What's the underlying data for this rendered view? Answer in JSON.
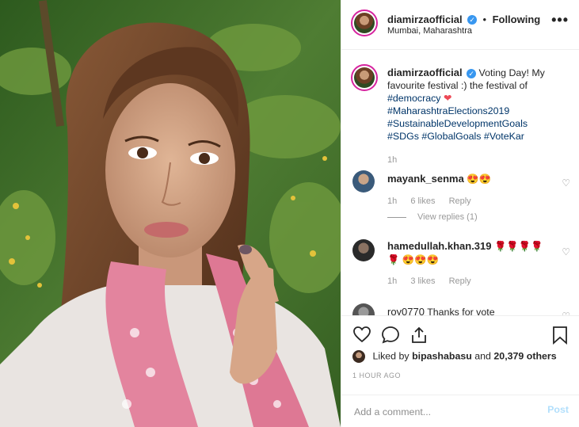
{
  "post": {
    "username": "diamirzaofficial",
    "verified_mark": "✓",
    "separator": "•",
    "follow_status": "Following",
    "location": "Mumbai, Maharashtra",
    "more_icon": "more-options-icon",
    "more_glyph": "•••"
  },
  "caption": {
    "username": "diamirzaofficial",
    "text": "Voting Day! My favourite festival :) the festival of",
    "tag1": "#democracy",
    "heart": "❤",
    "tag2": "#MaharashtraElections2019",
    "tag3": "#SustainableDevelopmentGoals",
    "tag4": "#SDGs",
    "tag5": "#GlobalGoals",
    "tag6": "#VoteKar",
    "time": "1h"
  },
  "comments": [
    {
      "username": "mayank_senma",
      "text": "😍😍",
      "time": "1h",
      "likes": "6 likes",
      "reply": "Reply",
      "view_replies": "View replies (1)"
    },
    {
      "username": "hamedullah.khan.319",
      "text": "🌹🌹🌹🌹🌹 😍😍😍",
      "time": "1h",
      "likes": "3 likes",
      "reply": "Reply"
    },
    {
      "username": "roy0770",
      "text": "Thanks for vote"
    }
  ],
  "actions": {
    "liked_by_prefix": "Liked by",
    "liked_by_user": "bipashabasu",
    "and": "and",
    "others": "20,379 others",
    "timestamp": "1 HOUR AGO"
  },
  "comment_box": {
    "placeholder": "Add a comment...",
    "post_label": "Post"
  },
  "colors": {
    "hashtag": "#003569",
    "verified": "#3897f0",
    "story_ring": "#d6249f",
    "post_disabled": "#b2dffc"
  }
}
